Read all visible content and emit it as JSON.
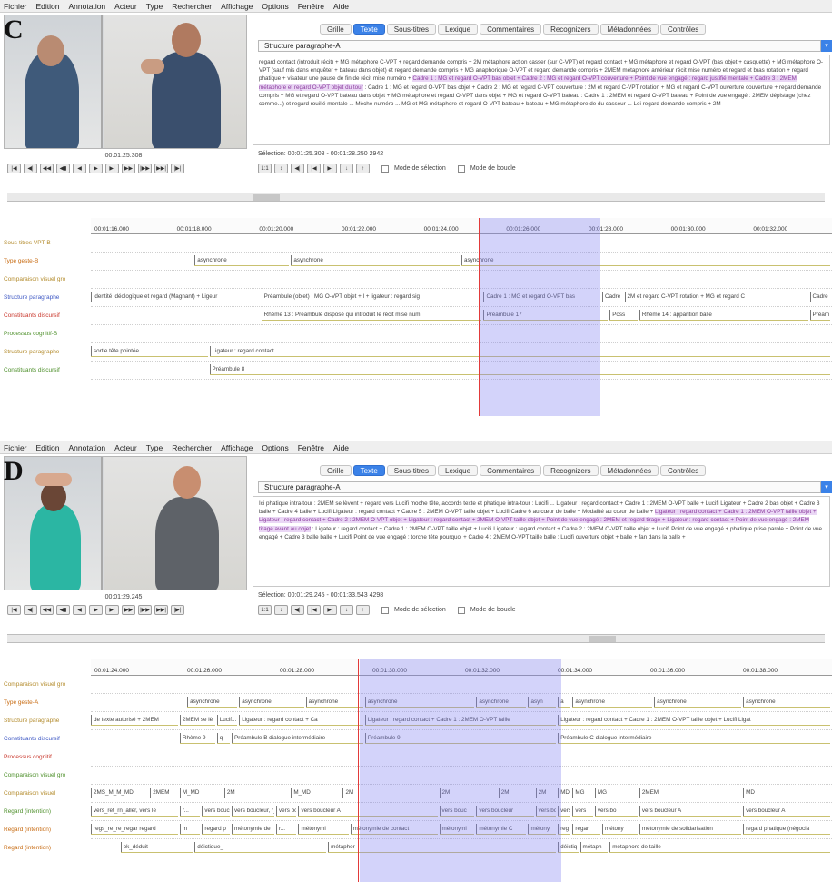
{
  "menu": [
    "Fichier",
    "Edition",
    "Annotation",
    "Acteur",
    "Type",
    "Rechercher",
    "Affichage",
    "Options",
    "Fenêtre",
    "Aide"
  ],
  "tabs": [
    "Grille",
    "Texte",
    "Sous-titres",
    "Lexique",
    "Commentaires",
    "Recognizers",
    "Métadonnées",
    "Contrôles"
  ],
  "active_tab": "Texte",
  "accent_color": "#3b82e8",
  "selection_color": "#8282f0",
  "cursor_color": "#e23a3a",
  "media_buttons": [
    "|◀",
    "◀|",
    "◀◀",
    "◀▮",
    "◀",
    "▶",
    "▶|",
    "▶▶",
    "|▶▶",
    "▶▶|",
    "|▶|"
  ],
  "annotation_buttons": [
    "1:1",
    "↕",
    "◀|",
    "|◀",
    "▶|",
    "↓",
    "↑"
  ],
  "mode_selection": "Mode de sélection",
  "mode_boucle": "Mode de boucle",
  "panelC": {
    "label": "C",
    "tier": "Structure paragraphe-A",
    "video_time": "00:01:25.308",
    "selection": "Sélection: 00:01:25.308 - 00:01:28.250  2942",
    "text_before": "regard contact (introduit récit) + MG métaphore C-VPT + regard demande compris + 2M métaphore action casser (sur C-VPT) et regard contact + MG métaphore et regard O-VPT (bas objet + casquette) + MG métaphore O-VPT (sauf mis dans enquêter + bateau dans objet) et regard demande compris + MG anaphorique O-VPT et regard demande compris + 2MEM métaphore antérieur récit mise numéro et regard et bras rotation + regard phatique + visateur une pause de fin de récit mise numéro + ",
    "text_highlight": "Cadre 1 : MG et regard O-VPT bas objet + Cadre 2 : MG et regard O-VPT couverture + Point de vue engagé : regard justifié mentale + Cadre 3 : 2MEM métaphore et regard O-VPT objet du tour",
    "text_after": " : Cadre 1 : MG et regard O-VPT bas objet + Cadre 2 : MG et regard C-VPT couverture : 2M et regard C-VPT rotation + MG et regard C-VPT ouverture couverture + regard demande compris + MG et regard O-VPT bateau dans objet + MG métaphore et regard O-VPT dans objet + MG et regard O-VPT bateau : Cadre 1 : 2MEM et regard O-VPT bateau + Point de vue engagé : 2MEM dépistage (chez comme...) et regard rouillé mentale ... Mèche numéro ... MG et MG métaphore et regard O-VPT bateau + bateau + MG métaphore de du casseur ... Lei regard demande compris + 2M",
    "ticks": [
      "00:01:16.000",
      "00:01:18.000",
      "00:01:20.000",
      "00:01:22.000",
      "00:01:24.000",
      "00:01:26.000",
      "00:01:28.000",
      "00:01:30.000",
      "00:01:32.000"
    ],
    "tier_labels": [
      "Sous-titres VPT-B",
      "Type geste-B",
      "Comparaison visuel gro",
      "Structure paragraphe",
      "Constituants discursif",
      "Processus cognitif-B",
      "Structure paragraphe",
      "Constituants discursif"
    ],
    "tracks": [
      [],
      [
        {
          "text": "asynchrone",
          "start": 0.14
        },
        {
          "text": "asynchrone",
          "start": 0.27
        },
        {
          "text": "asynchrone",
          "start": 0.5
        }
      ],
      [],
      [
        {
          "text": "identité idéologique et regard (Magnant) + Ligeur",
          "start": 0.0
        },
        {
          "text": "Préambule (objet) : MG O-VPT objet + l + ligateur : regard sig",
          "start": 0.23
        },
        {
          "text": "Cadre 1 : MG et regard O-VPT bas",
          "start": 0.53
        },
        {
          "text": "Cadre",
          "start": 0.69
        },
        {
          "text": "2M et regard C-VPT rotation + MG et regard C",
          "start": 0.72
        },
        {
          "text": "Cadre",
          "start": 0.97
        }
      ],
      [
        {
          "text": "Rhème 13 : Préambule disposé qui introduit le récit mise num",
          "start": 0.23
        },
        {
          "text": "Préambule 17",
          "start": 0.53
        },
        {
          "text": "Poss",
          "start": 0.7
        },
        {
          "text": "Rhème 14 : apparition balle",
          "start": 0.74
        },
        {
          "text": "Préam",
          "start": 0.97
        }
      ],
      [],
      [
        {
          "text": "sortie tête pointée",
          "start": 0.0
        },
        {
          "text": "Ligateur : regard contact",
          "start": 0.16
        }
      ],
      [
        {
          "text": "Préambule 8",
          "start": 0.16
        }
      ]
    ]
  },
  "panelD": {
    "label": "D",
    "tier": "Structure paragraphe-A",
    "video_time": "00:01:29.245",
    "selection": "Sélection: 00:01:29.245 - 00:01:33.543  4298",
    "text_before": "Ici phatique intra-tour : 2MEM se lèvent + regard vers Lucifi moche tête, accords texte et phatique intra-tour : Lucifi ... Ligateur : regard contact + Cadre 1 : 2MEM O-VPT balle + Lucifi Ligateur + Cadre 2 bas objet + Cadre 3 balle + Cadre 4 balle + Lucifi Ligateur : regard contact + Cadre 5 : 2MEM O-VPT taille objet + Lucifi Cadre 6 au cœur de balle + Modalité au cœur de balle + ",
    "text_highlight": "Ligateur : regard contact + Cadre 1 : 2MEM O-VPT taille objet + Ligateur : regard contact + Cadre 2 : 2MEM O-VPT objet + Ligateur : regard contact + 2MEM O-VPT taille objet + Point de vue engagé : 2MEM et regard tirage + Ligateur : regard contact + Point de vue engagé : 2MEM tirage avant au objet",
    "text_after": " : Ligateur : regard contact + Cadre 1 : 2MEM O-VPT taille objet + Lucifi Ligateur : regard contact + Cadre 2 : 2MEM O-VPT taille objet + Lucifi Point de vue engagé + phatique prise parole + Point de vue engagé + Cadre 3 balle balle + Lucifi Point de vue engagé : torche tête pourquoi + Cadre 4 : 2MEM O-VPT taille balle : Lucifi ouverture objet + balle + fan dans la balle +",
    "ticks": [
      "00:01:24.000",
      "00:01:26.000",
      "00:01:28.000",
      "00:01:30.000",
      "00:01:32.000",
      "00:01:34.000",
      "00:01:36.000",
      "00:01:38.000"
    ],
    "tier_labels": [
      "Comparaison visuel gro",
      "Type geste-A",
      "Structure paragraphe",
      "Constituants discursif",
      "Processus cognitif",
      "Comparaison visuel gro",
      "Comparaison visuel",
      "Regard (intention)",
      "Regard (intention)",
      "Regard (intention)"
    ],
    "tracks": [
      [],
      [
        {
          "text": "asynchrone",
          "start": 0.13
        },
        {
          "text": "asynchrone",
          "start": 0.2
        },
        {
          "text": "asynchrone",
          "start": 0.29
        },
        {
          "text": "asynchrone",
          "start": 0.37
        },
        {
          "text": "asynchrone",
          "start": 0.52
        },
        {
          "text": "asyn",
          "start": 0.59
        },
        {
          "text": "a",
          "start": 0.63
        },
        {
          "text": "asynchrone",
          "start": 0.65
        },
        {
          "text": "asynchrone",
          "start": 0.76
        },
        {
          "text": "asynchrone",
          "start": 0.88
        }
      ],
      [
        {
          "text": "de texte autorisé + 2MEM",
          "start": 0.0
        },
        {
          "text": "2MEM se lè",
          "start": 0.12
        },
        {
          "text": "Lucif...",
          "start": 0.17
        },
        {
          "text": "Ligateur : regard contact + Ca",
          "start": 0.2
        },
        {
          "text": "Ligateur : regard contact + Cadre 1 : 2MEM O-VPT taille",
          "start": 0.37
        },
        {
          "text": "Ligateur : regard contact + Cadre 1 : 2MEM O-VPT taille objet + Lucifi Ligat",
          "start": 0.63
        }
      ],
      [
        {
          "text": "Rhème 9",
          "start": 0.12
        },
        {
          "text": "q",
          "start": 0.17
        },
        {
          "text": "Préambule B dialogue intermédiaire",
          "start": 0.19
        },
        {
          "text": "Préambule 9",
          "start": 0.37
        },
        {
          "text": "Préambule C dialogue intermédiaire",
          "start": 0.63
        }
      ],
      [],
      [],
      [
        {
          "text": "2MS_M_M_MD",
          "start": 0.0
        },
        {
          "text": "2MEM",
          "start": 0.08
        },
        {
          "text": "M_MD",
          "start": 0.12
        },
        {
          "text": "2M",
          "start": 0.18
        },
        {
          "text": "M_MD",
          "start": 0.27
        },
        {
          "text": "2M",
          "start": 0.34
        },
        {
          "text": "2M",
          "start": 0.47
        },
        {
          "text": "2M",
          "start": 0.55
        },
        {
          "text": "2M",
          "start": 0.6
        },
        {
          "text": "MD",
          "start": 0.63
        },
        {
          "text": "MG",
          "start": 0.65
        },
        {
          "text": "MG",
          "start": 0.68
        },
        {
          "text": "2MEM",
          "start": 0.74
        },
        {
          "text": "MD",
          "start": 0.88
        }
      ],
      [
        {
          "text": "vers_ret_rn_aller, vers le",
          "start": 0.0
        },
        {
          "text": "r...",
          "start": 0.12
        },
        {
          "text": "vers bouc",
          "start": 0.15
        },
        {
          "text": "vers boucleur, r_ rat",
          "start": 0.19
        },
        {
          "text": "vers bouc",
          "start": 0.25
        },
        {
          "text": "vers boucleur A",
          "start": 0.28
        },
        {
          "text": "vers bouc",
          "start": 0.47
        },
        {
          "text": "vers boucleur",
          "start": 0.52
        },
        {
          "text": "vers bou",
          "start": 0.6
        },
        {
          "text": "vers",
          "start": 0.63
        },
        {
          "text": "vers",
          "start": 0.65
        },
        {
          "text": "vers bo",
          "start": 0.68
        },
        {
          "text": "vers boucleur A",
          "start": 0.74
        },
        {
          "text": "vers boucleur A",
          "start": 0.88
        }
      ],
      [
        {
          "text": "regs_re_re_regar regard",
          "start": 0.0
        },
        {
          "text": "m",
          "start": 0.12
        },
        {
          "text": "regard p",
          "start": 0.15
        },
        {
          "text": "métonymie de",
          "start": 0.19
        },
        {
          "text": "r...",
          "start": 0.25
        },
        {
          "text": "métonymi",
          "start": 0.28
        },
        {
          "text": "métonymie de contact",
          "start": 0.35
        },
        {
          "text": "métonymi",
          "start": 0.47
        },
        {
          "text": "métonymie C",
          "start": 0.52
        },
        {
          "text": "métony",
          "start": 0.59
        },
        {
          "text": "reg",
          "start": 0.63
        },
        {
          "text": "regar",
          "start": 0.65
        },
        {
          "text": "métony",
          "start": 0.69
        },
        {
          "text": "métonymie de solidarisation",
          "start": 0.74
        },
        {
          "text": "regard phatique (négocia",
          "start": 0.88
        }
      ],
      [
        {
          "text": "ok_déduit",
          "start": 0.04
        },
        {
          "text": "déictique_",
          "start": 0.14
        },
        {
          "text": "métaphor",
          "start": 0.32
        },
        {
          "text": "déictiq",
          "start": 0.63
        },
        {
          "text": "métaph",
          "start": 0.66
        },
        {
          "text": "métaphore de taille",
          "start": 0.7
        }
      ]
    ]
  }
}
